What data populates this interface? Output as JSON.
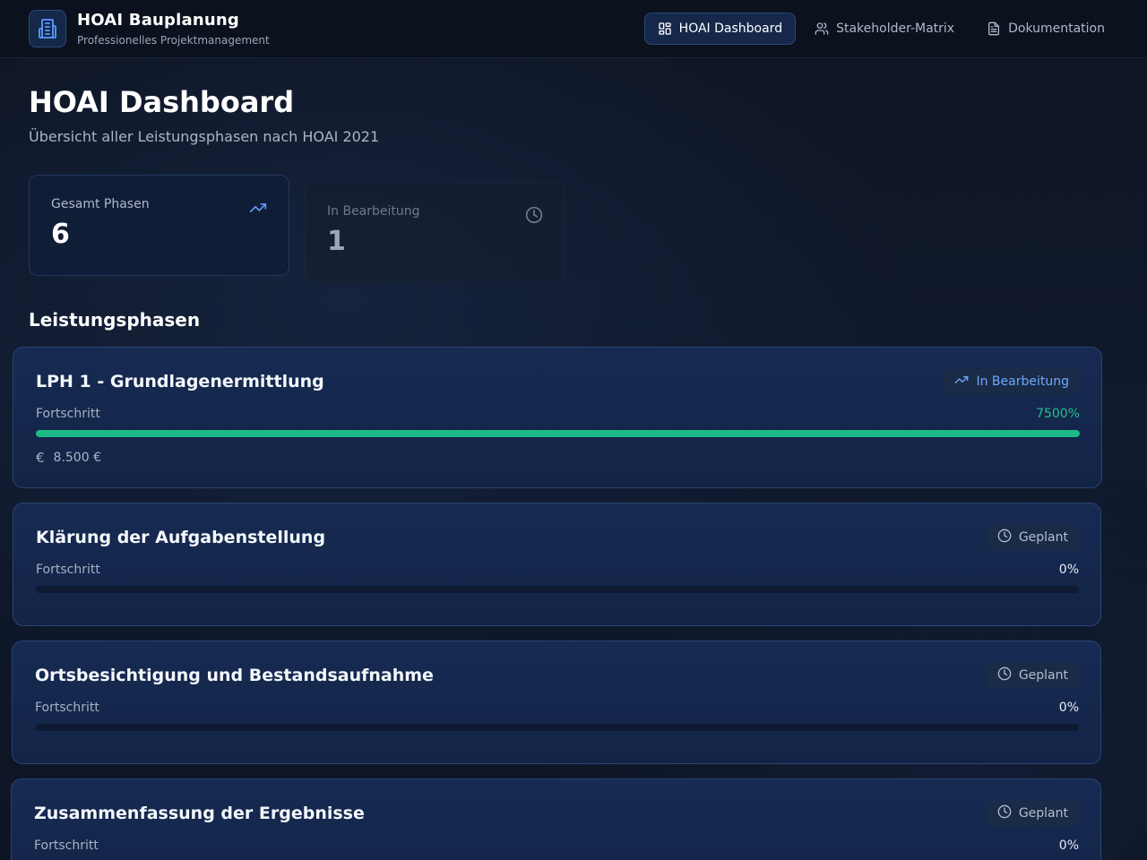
{
  "app": {
    "title": "HOAI Bauplanung",
    "subtitle": "Professionelles Projektmanagement"
  },
  "nav": {
    "items": [
      {
        "label": "HOAI Dashboard",
        "icon": "grid-icon",
        "active": true
      },
      {
        "label": "Stakeholder-Matrix",
        "icon": "users-icon",
        "active": false
      },
      {
        "label": "Dokumentation",
        "icon": "document-icon",
        "active": false
      }
    ]
  },
  "page": {
    "title": "HOAI Dashboard",
    "subtitle": "Übersicht aller Leistungsphasen nach HOAI 2021"
  },
  "stats": [
    {
      "label": "Gesamt Phasen",
      "value": "6",
      "icon": "trending-up-icon"
    },
    {
      "label": "In Bearbeitung",
      "value": "1",
      "icon": "clock-icon"
    }
  ],
  "section": {
    "title": "Leistungsphasen"
  },
  "phases": [
    {
      "name": "LPH 1 - Grundlagenermittlung",
      "status": "In Bearbeitung",
      "status_icon": "trending-up-icon",
      "progress_label": "Fortschritt",
      "progress_text": "7500%",
      "progress_fraction": 1.0,
      "cost": "8.500 €"
    },
    {
      "name": "Klärung der Aufgabenstellung",
      "status": "Geplant",
      "status_icon": "clock-icon",
      "progress_label": "Fortschritt",
      "progress_text": "0%",
      "progress_fraction": 0
    },
    {
      "name": "Ortsbesichtigung und Bestandsaufnahme",
      "status": "Geplant",
      "status_icon": "clock-icon",
      "progress_label": "Fortschritt",
      "progress_text": "0%",
      "progress_fraction": 0
    },
    {
      "name": "Zusammenfassung der Ergebnisse",
      "status": "Geplant",
      "status_icon": "clock-icon",
      "progress_label": "Fortschritt",
      "progress_text": "0%",
      "progress_fraction": 0
    }
  ],
  "colors": {
    "accent": "#6ea8ff",
    "progress": "#1cba86",
    "background": "#0f1626"
  }
}
